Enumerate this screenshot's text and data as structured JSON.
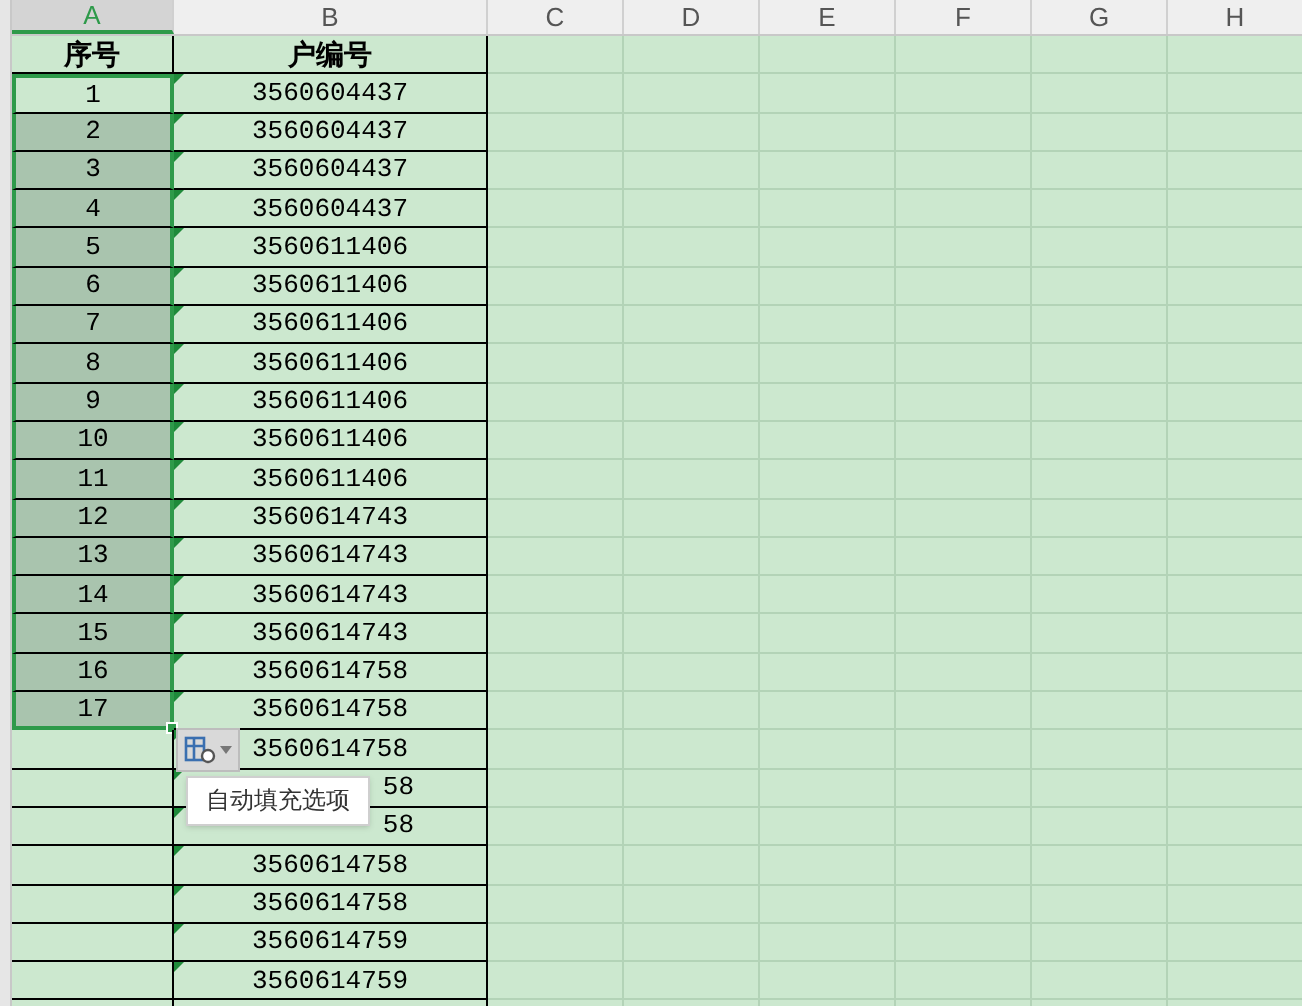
{
  "column_headers": [
    {
      "label": "A",
      "selected": true
    },
    {
      "label": "B",
      "selected": false
    },
    {
      "label": "C",
      "selected": false
    },
    {
      "label": "D",
      "selected": false
    },
    {
      "label": "E",
      "selected": false
    },
    {
      "label": "F",
      "selected": false
    },
    {
      "label": "G",
      "selected": false
    },
    {
      "label": "H",
      "selected": false
    }
  ],
  "table": {
    "header": [
      "序号",
      "户编号"
    ],
    "rows": [
      {
        "index": "1",
        "id": "3560604437",
        "selected": true,
        "active": true
      },
      {
        "index": "2",
        "id": "3560604437",
        "selected": true,
        "active": false
      },
      {
        "index": "3",
        "id": "3560604437",
        "selected": true,
        "active": false
      },
      {
        "index": "4",
        "id": "3560604437",
        "selected": true,
        "active": false
      },
      {
        "index": "5",
        "id": "3560611406",
        "selected": true,
        "active": false
      },
      {
        "index": "6",
        "id": "3560611406",
        "selected": true,
        "active": false
      },
      {
        "index": "7",
        "id": "3560611406",
        "selected": true,
        "active": false
      },
      {
        "index": "8",
        "id": "3560611406",
        "selected": true,
        "active": false
      },
      {
        "index": "9",
        "id": "3560611406",
        "selected": true,
        "active": false
      },
      {
        "index": "10",
        "id": "3560611406",
        "selected": true,
        "active": false
      },
      {
        "index": "11",
        "id": "3560611406",
        "selected": true,
        "active": false
      },
      {
        "index": "12",
        "id": "3560614743",
        "selected": true,
        "active": false
      },
      {
        "index": "13",
        "id": "3560614743",
        "selected": true,
        "active": false
      },
      {
        "index": "14",
        "id": "3560614743",
        "selected": true,
        "active": false
      },
      {
        "index": "15",
        "id": "3560614743",
        "selected": true,
        "active": false
      },
      {
        "index": "16",
        "id": "3560614758",
        "selected": true,
        "active": false
      },
      {
        "index": "17",
        "id": "3560614758",
        "selected": true,
        "active": false
      },
      {
        "id": "3560614758",
        "selected": false
      },
      {
        "id": "58",
        "kind": "covered",
        "selected": false
      },
      {
        "id": "58",
        "kind": "covered",
        "selected": false
      },
      {
        "id": "3560614758",
        "selected": false
      },
      {
        "id": "3560614758",
        "selected": false
      },
      {
        "id": "3560614759",
        "selected": false
      },
      {
        "id": "3560614759",
        "selected": false
      }
    ]
  },
  "autofill": {
    "tooltip": "自动填充选项"
  }
}
